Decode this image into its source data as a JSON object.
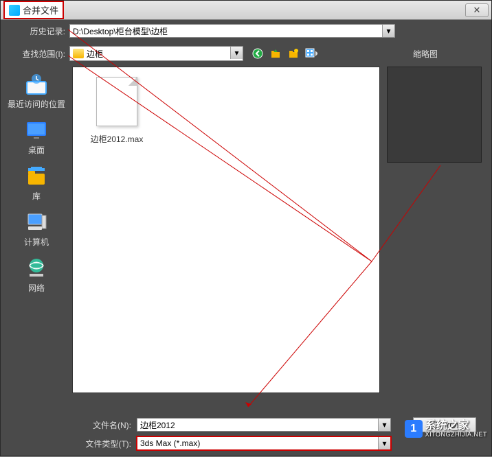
{
  "title": "合并文件",
  "history": {
    "label": "历史记录:",
    "value": "D:\\Desktop\\柜台模型\\边柜"
  },
  "lookin": {
    "label": "查找范围(I):",
    "value": "边柜"
  },
  "thumbnail_label": "缩略图",
  "sidebar": {
    "items": [
      {
        "label": "最近访问的位置",
        "icon": "recent"
      },
      {
        "label": "桌面",
        "icon": "desktop"
      },
      {
        "label": "库",
        "icon": "library"
      },
      {
        "label": "计算机",
        "icon": "computer"
      },
      {
        "label": "网络",
        "icon": "network"
      }
    ]
  },
  "files": [
    {
      "name": "边柜2012.max"
    }
  ],
  "filename": {
    "label": "文件名(N):",
    "value": "边柜2012"
  },
  "filetype": {
    "label": "文件类型(T):",
    "value": "3ds Max (*.max)"
  },
  "open_btn": "打开(O)",
  "watermark": {
    "badge": "1",
    "text": "系统之家",
    "url": "XITONGZHIJIA.NET"
  },
  "toolbar_icons": [
    "back-icon",
    "up-icon",
    "create-folder-icon",
    "view-icon"
  ]
}
